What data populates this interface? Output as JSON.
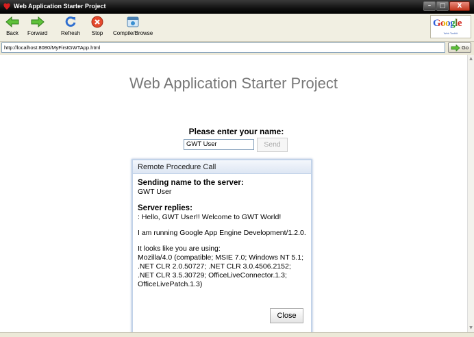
{
  "window": {
    "title": "Web Application Starter Project"
  },
  "toolbar": {
    "back": "Back",
    "forward": "Forward",
    "refresh": "Refresh",
    "stop": "Stop",
    "compile": "Compile/Browse"
  },
  "logo": {
    "text": "Google",
    "subtitle": "Web Toolkit"
  },
  "address": {
    "url": "http://localhost:8080/MyFirstGWTApp.html",
    "go": "Go"
  },
  "page": {
    "title": "Web Application Starter Project",
    "prompt": "Please enter your name:",
    "name_value": "GWT User",
    "send": "Send"
  },
  "dialog": {
    "caption": "Remote Procedure Call",
    "sending_heading": "Sending name to the server:",
    "sending_value": "GWT User",
    "replies_heading": "Server replies:",
    "reply_line": ": Hello, GWT User!! Welcome to GWT World!",
    "running_line": "I am running Google App Engine Development/1.2.0.",
    "using_intro": "It looks like you are using:",
    "ua_1": "Mozilla/4.0 (compatible; MSIE 7.0; Windows NT 5.1;",
    "ua_2": ".NET CLR 2.0.50727; .NET CLR 3.0.4506.2152;",
    "ua_3": ".NET CLR 3.5.30729; OfficeLiveConnector.1.3;",
    "ua_4": "OfficeLivePatch.1.3)",
    "close": "Close"
  },
  "colors": {
    "title_bar": "#000000",
    "page_title": "#777777",
    "dialog_border": "#c2d3e9"
  }
}
